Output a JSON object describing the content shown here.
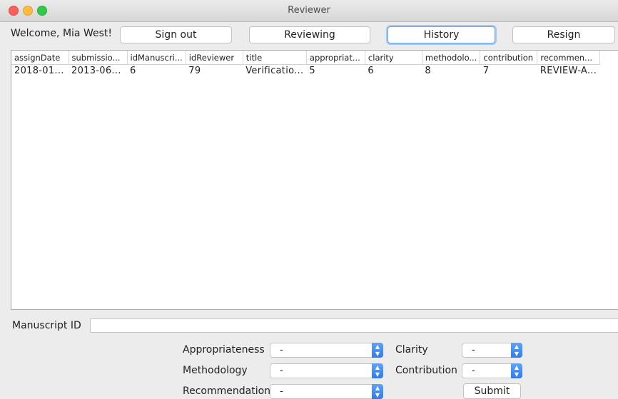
{
  "window": {
    "title": "Reviewer"
  },
  "header": {
    "welcome": "Welcome, Mia West!",
    "buttons": {
      "sign_out": "Sign out",
      "reviewing": "Reviewing",
      "history": "History",
      "resign": "Resign"
    }
  },
  "table": {
    "columns": [
      "assignDate",
      "submissio...",
      "idManuscri...",
      "idReviewer",
      "title",
      "appropriat...",
      "clarity",
      "methodolo...",
      "contribution",
      "recommen..."
    ],
    "rows": [
      [
        "2018-01...",
        "2013-06...",
        "6",
        "79",
        "Verificatio...",
        "5",
        "6",
        "8",
        "7",
        "REVIEW-A..."
      ]
    ]
  },
  "form": {
    "manuscript_id_label": "Manuscript ID",
    "manuscript_id_value": "",
    "appropriateness": {
      "label": "Appropriateness",
      "value": "-"
    },
    "methodology": {
      "label": "Methodology",
      "value": "-"
    },
    "recommendation": {
      "label": "Recommendation",
      "value": "-"
    },
    "clarity": {
      "label": "Clarity",
      "value": "-"
    },
    "contribution": {
      "label": "Contribution",
      "value": "-"
    },
    "submit_label": "Submit"
  },
  "colors": {
    "accent": "#2e7bee",
    "close": "#fc605b",
    "minimize": "#fdbc40",
    "zoom": "#34c84a"
  }
}
